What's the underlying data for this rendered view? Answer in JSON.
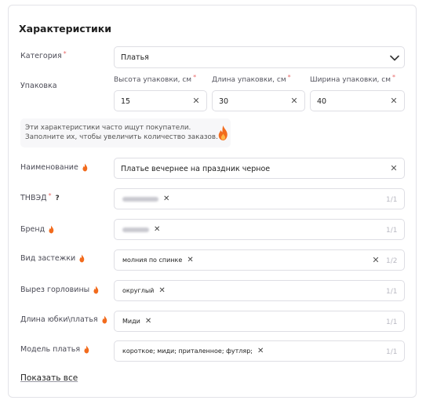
{
  "section_title": "Характеристики",
  "category": {
    "label": "Категория",
    "required_mark": "*",
    "value": "Платья"
  },
  "packaging": {
    "label": "Упаковка",
    "height": {
      "label": "Высота упаковки, см",
      "required_mark": "*",
      "value": "15"
    },
    "length": {
      "label": "Длина упаковки, см",
      "required_mark": "*",
      "value": "30"
    },
    "width": {
      "label": "Ширина упаковки, см",
      "required_mark": "*",
      "value": "40"
    }
  },
  "tip": {
    "line1": "Эти характеристики часто ищут покупатели.",
    "line2": "Заполните их, чтобы увеличить количество заказов."
  },
  "name_field": {
    "label": "Наименование",
    "value": "Платье вечернее на праздник черное"
  },
  "tnved": {
    "label": "ТНВЭД",
    "required_mark": "*",
    "help": "?",
    "count": "1/1"
  },
  "brand": {
    "label": "Бренд",
    "count": "1/1"
  },
  "fastener": {
    "label": "Вид застежки",
    "chip": "молния по спинке",
    "count": "1/2"
  },
  "neckline": {
    "label": "Вырез горловины",
    "chip": "округлый",
    "count": "1/1"
  },
  "skirt_length": {
    "label": "Длина юбки\\платья",
    "chip": "Миди",
    "count": "1/1"
  },
  "dress_model": {
    "label": "Модель платья",
    "chip": "короткое; миди; приталенное; футляр;",
    "count": "1/1"
  },
  "show_all": "Показать все",
  "colors": {
    "fire": "#f26b1d",
    "required": "#e96a6a",
    "border": "#dedee4",
    "muted": "#b8b8c2"
  },
  "icons": {
    "fire": "fire-icon",
    "clear": "close-icon",
    "dropdown": "chevron-down-icon"
  }
}
